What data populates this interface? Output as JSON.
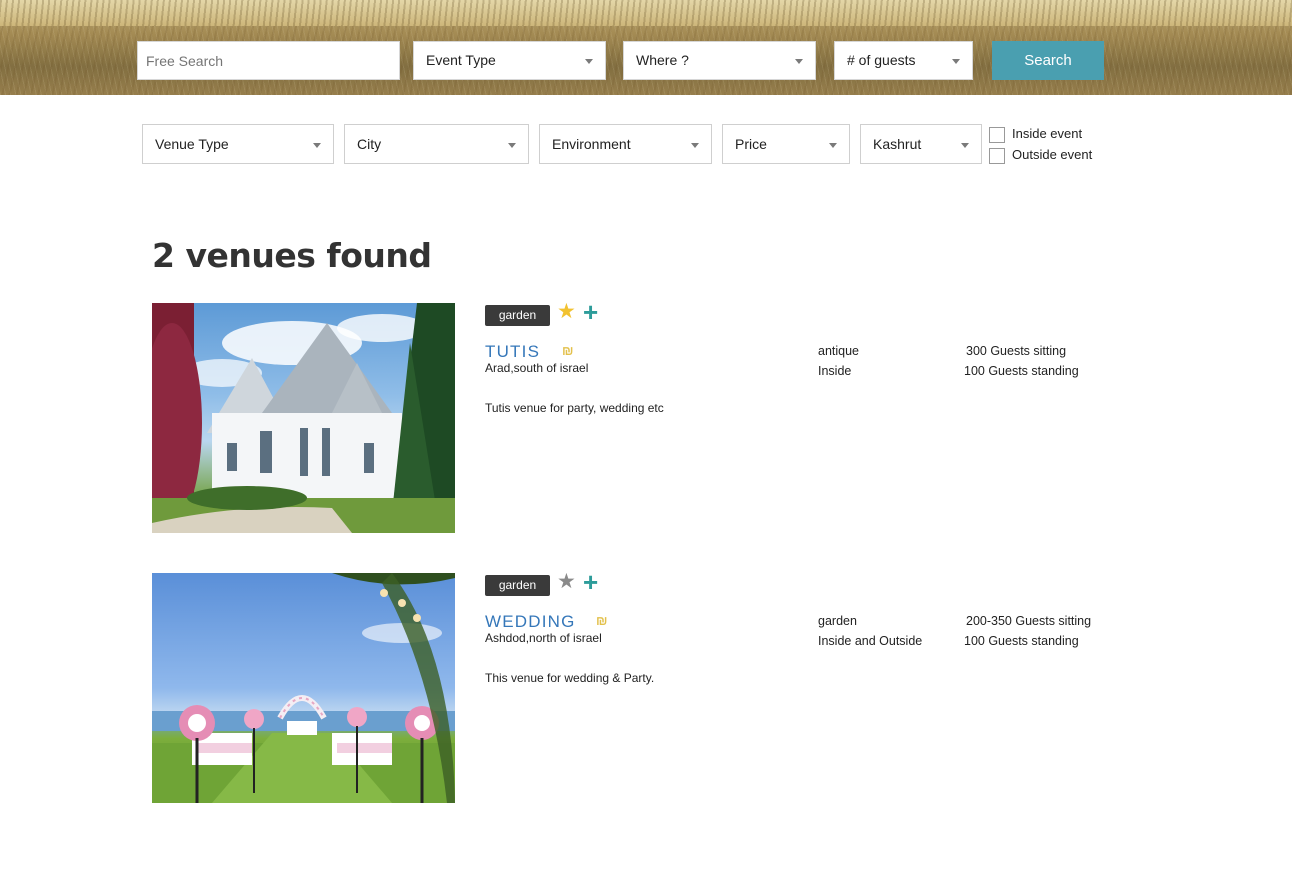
{
  "search_bar": {
    "free_search_placeholder": "Free Search",
    "event_type": "Event Type",
    "where": "Where ?",
    "guests": "# of guests",
    "search_label": "Search",
    "accent_color": "#4a9fb0"
  },
  "filters": {
    "venue_type": "Venue Type",
    "city": "City",
    "environment": "Environment",
    "price": "Price",
    "kashrut": "Kashrut",
    "inside_event": "Inside event",
    "outside_event": "Outside event"
  },
  "results": {
    "heading": "2 venues found",
    "venues": [
      {
        "tag": "garden",
        "favorite": true,
        "star_color": "#f2c230",
        "name": "TUTIS",
        "currency_symbol": "₪",
        "location": "Arad,south of israel",
        "description": "Tutis venue for party, wedding etc",
        "style": "antique",
        "setting": "Inside",
        "sitting": "300 Guests sitting",
        "standing": "100 Guests standing",
        "image": "white-mansion-photo"
      },
      {
        "tag": "garden",
        "favorite": false,
        "star_color": "#8a8a8a",
        "name": "WEDDING",
        "currency_symbol": "₪",
        "location": "Ashdod,north of israel",
        "description": "This venue for wedding & Party.",
        "style": "garden",
        "setting": "Inside and Outside",
        "sitting": "200-350 Guests sitting",
        "standing": "100 Guests standing",
        "image": "seaside-wedding-aisle-photo"
      }
    ]
  }
}
